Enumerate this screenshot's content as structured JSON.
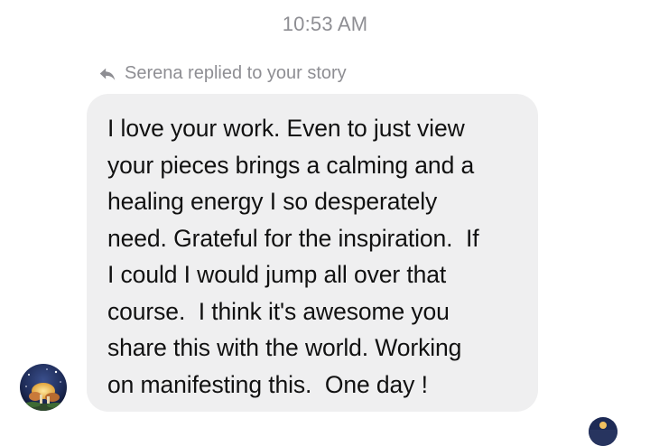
{
  "timestamp": "10:53 AM",
  "reply_note": {
    "icon": "reply-arrow-icon",
    "text": "Serena replied to your story"
  },
  "message": {
    "lines": [
      "I love your work. Even to just view",
      "your pieces brings a calming and a",
      "healing energy I so desperately",
      "need. Grateful for the inspiration.  If",
      "I could I would jump all over that",
      "course.  I think it's awesome you",
      "share this with the world. Working",
      "on manifesting this.  One day !"
    ]
  },
  "sender_avatar": {
    "icon": "sender-avatar"
  },
  "seen_avatar": {
    "icon": "read-receipt-avatar"
  },
  "colors": {
    "bubble": "#efeff0",
    "meta_text": "#8e8e93",
    "message_text": "#111111"
  }
}
